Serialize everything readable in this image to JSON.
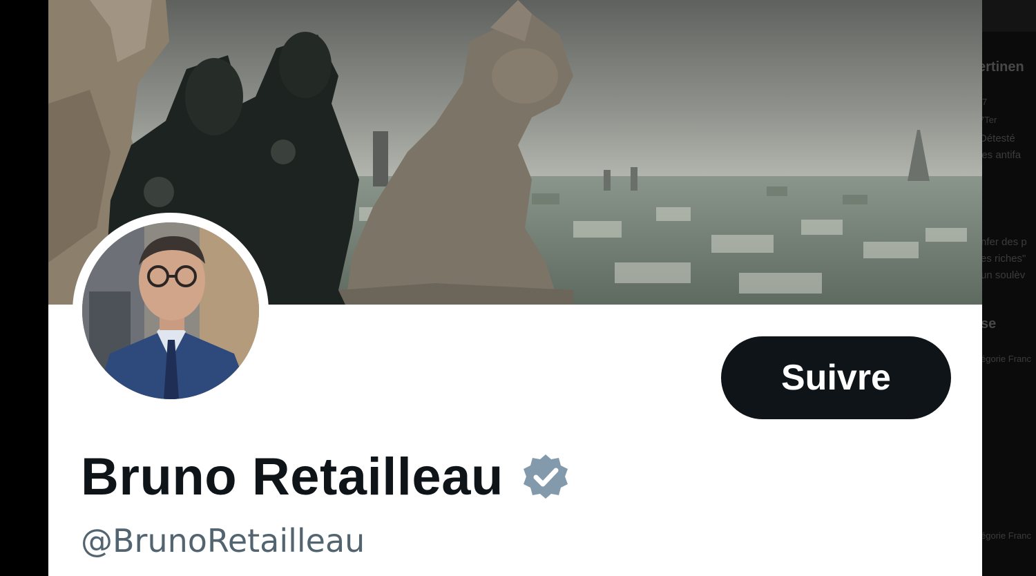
{
  "profile": {
    "display_name": "Bruno Retailleau",
    "handle": "@BrunoRetailleau",
    "follow_label": "Suivre",
    "verified": true,
    "verified_badge_color": "#829aab",
    "follow_button_color": "#0f1419"
  },
  "sidebar": {
    "heading": "ertinen",
    "meta": "7",
    "meta2": "7Ter",
    "line1": "Détesté",
    "line2": "les antifa",
    "line3": "nfer des p",
    "line4": "es riches\"",
    "line5": "un soulèv",
    "heading2": "se",
    "footer1": "égorie Franc",
    "footer2": "égorie Franc"
  },
  "icons": {
    "badge": "verified-badge-icon"
  }
}
